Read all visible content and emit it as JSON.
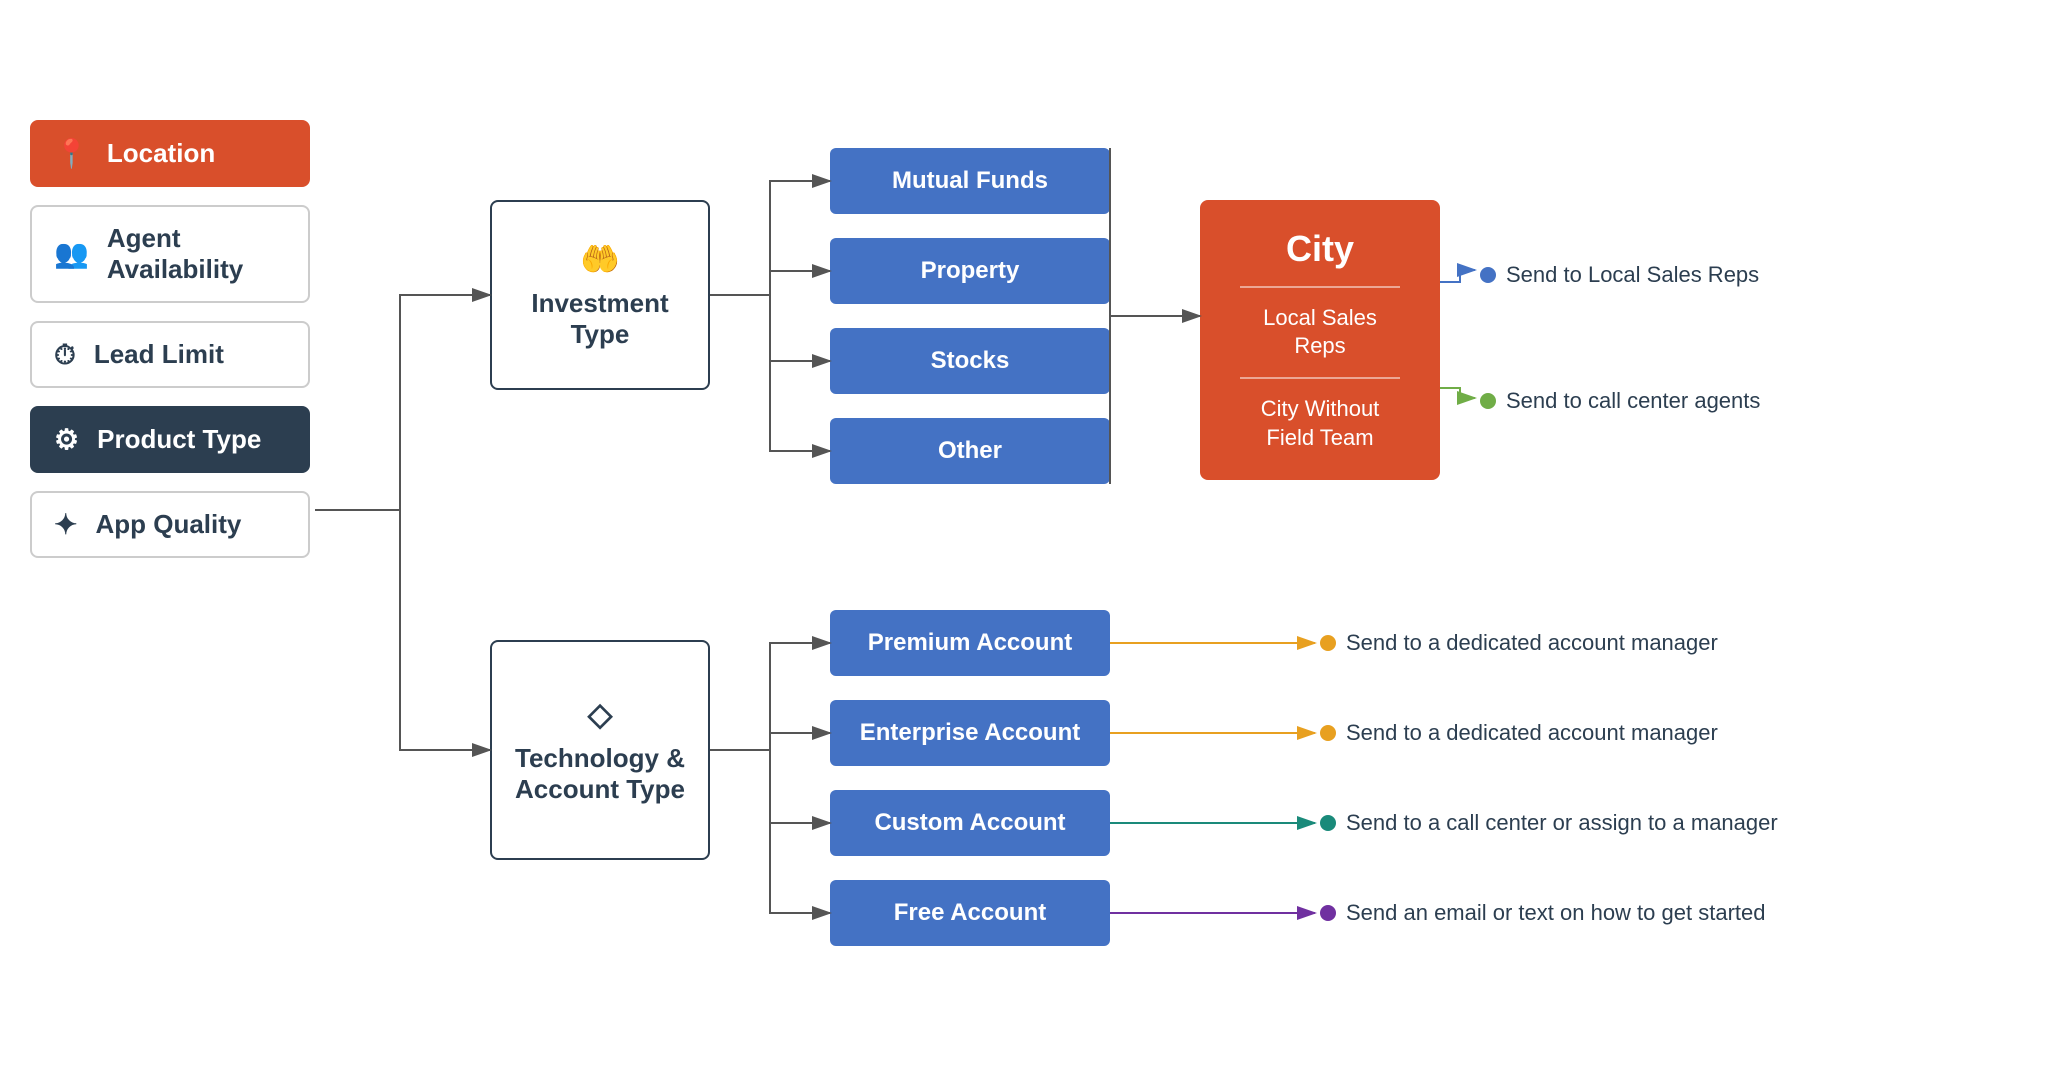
{
  "sidebar": {
    "items": [
      {
        "id": "location",
        "label": "Location",
        "icon": "📍",
        "state": "active-orange"
      },
      {
        "id": "agent-availability",
        "label": "Agent Availability",
        "icon": "👥",
        "state": "default"
      },
      {
        "id": "lead-limit",
        "label": "Lead Limit",
        "icon": "⏱",
        "state": "default"
      },
      {
        "id": "product-type",
        "label": "Product Type",
        "icon": "⚙",
        "state": "active-dark"
      },
      {
        "id": "app-quality",
        "label": "App Quality",
        "icon": "✦",
        "state": "default"
      }
    ]
  },
  "nodes": {
    "investment_type": {
      "label": "Investment Type",
      "icon": "🤲"
    },
    "technology_account_type": {
      "label": "Technology &\nAccount Type",
      "icon": "◇"
    }
  },
  "investment_options": [
    {
      "id": "mutual-funds",
      "label": "Mutual Funds"
    },
    {
      "id": "property",
      "label": "Property"
    },
    {
      "id": "stocks",
      "label": "Stocks"
    },
    {
      "id": "other",
      "label": "Other"
    }
  ],
  "city_box": {
    "city_label": "City",
    "sub1": "Local Sales\nReps",
    "sub2": "City Without\nField Team"
  },
  "city_outputs": [
    {
      "id": "local-sales",
      "label": "Send to Local Sales Reps",
      "color": "#4472c4"
    },
    {
      "id": "call-center",
      "label": "Send to call center agents",
      "color": "#70ad47"
    }
  ],
  "account_options": [
    {
      "id": "premium-account",
      "label": "Premium Account"
    },
    {
      "id": "enterprise-account",
      "label": "Enterprise Account"
    },
    {
      "id": "custom-account",
      "label": "Custom Account"
    },
    {
      "id": "free-account",
      "label": "Free Account"
    }
  ],
  "account_outputs": [
    {
      "id": "premium-output",
      "label": "Send to a dedicated account manager",
      "color": "#e8a020"
    },
    {
      "id": "enterprise-output",
      "label": "Send to a dedicated account manager",
      "color": "#e8a020"
    },
    {
      "id": "custom-output",
      "label": "Send to a call center or assign to a manager",
      "color": "#1a8a7a"
    },
    {
      "id": "free-output",
      "label": "Send an email or text on how to get started",
      "color": "#7030a0"
    }
  ]
}
